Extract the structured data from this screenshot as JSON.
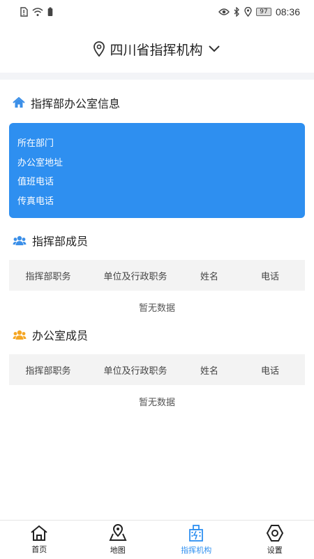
{
  "status_bar": {
    "time": "08:36",
    "battery": "97"
  },
  "header": {
    "title": "四川省指挥机构"
  },
  "office_info": {
    "title": "指挥部办公室信息",
    "rows": [
      "所在部门",
      "办公室地址",
      "值班电话",
      "传真电话"
    ]
  },
  "command_members": {
    "title": "指挥部成员",
    "columns": [
      "指挥部职务",
      "单位及行政职务",
      "姓名",
      "电话"
    ],
    "empty": "暂无数据"
  },
  "office_members": {
    "title": "办公室成员",
    "columns": [
      "指挥部职务",
      "单位及行政职务",
      "姓名",
      "电话"
    ],
    "empty": "暂无数据"
  },
  "nav": {
    "items": [
      {
        "label": "首页",
        "icon": "home-icon"
      },
      {
        "label": "地图",
        "icon": "map-icon"
      },
      {
        "label": "指挥机构",
        "icon": "building-icon"
      },
      {
        "label": "设置",
        "icon": "settings-icon"
      }
    ],
    "active_color": "#2e8ff0"
  },
  "colors": {
    "card": "#2e8ff0",
    "section_icon_blue": "#3b8fe8",
    "section_icon_orange": "#f5a623"
  }
}
